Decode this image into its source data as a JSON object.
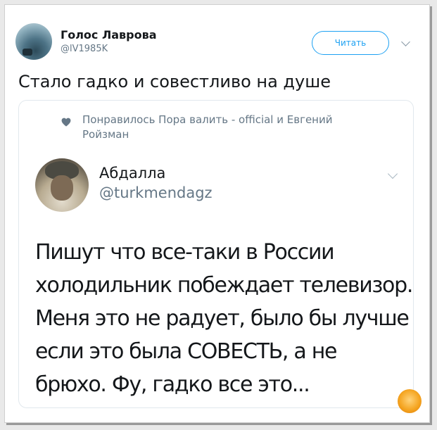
{
  "tweet": {
    "author_name": "Голос Лаврова",
    "author_handle": "@lV1985K",
    "follow_label": "Читать",
    "text": "Стало гадко и совестливо на душе"
  },
  "quote": {
    "liked_by": "Понравилось Пора валить - official и Евгений Ройзман",
    "author_name": "Абдалла",
    "author_handle": "@turkmendagz",
    "text_lines": [
      "Пишут что все-таки в России",
      "холодильник побеждает телевизор.",
      "Меня это не радует, было бы лучше",
      "если это была СОВЕСТЬ, а не",
      "брюхо. Фу, гадко все это..."
    ]
  },
  "colors": {
    "accent": "#1da1f2",
    "secondary_text": "#657786",
    "primary_text": "#14171a"
  },
  "icons": [
    "chevron-down-icon",
    "heart-icon"
  ]
}
